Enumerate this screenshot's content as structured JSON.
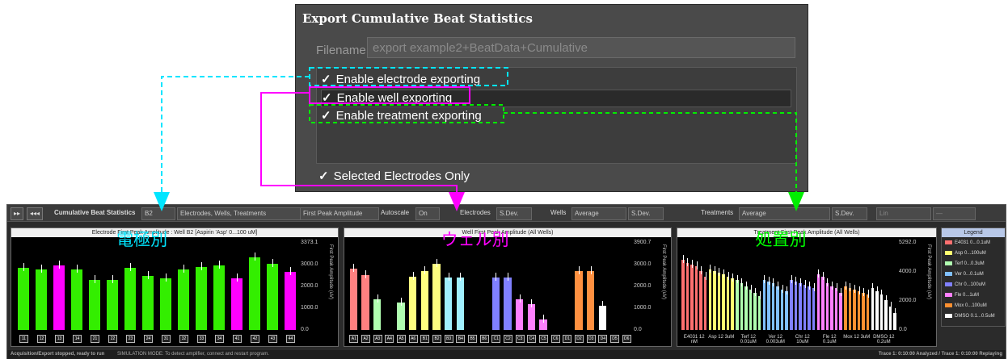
{
  "dialog": {
    "title": "Export Cumulative Beat Statistics",
    "filename_label": "Filename",
    "filename_value": "export example2+BeatData+Cumulative",
    "options": [
      {
        "label": "Enable electrode exporting",
        "checked": true
      },
      {
        "label": "Enable well exporting",
        "checked": true
      },
      {
        "label": "Enable treatment exporting",
        "checked": true
      }
    ],
    "selected_only": {
      "label": "Selected Electrodes Only",
      "checked": true
    },
    "check_glyph": "✓"
  },
  "toolbar": {
    "btn1": "▸▸",
    "btn2": "◂◂◂",
    "title": "Cumulative Beat Statistics",
    "well": "B2",
    "view": "Electrodes, Wells, Treatments",
    "metric": "First Peak Amplitude",
    "autoscale_label": "Autoscale",
    "autoscale_value": "On",
    "electrodes_label": "Electrodes",
    "electrodes_value": "S.Dev.",
    "wells_label": "Wells",
    "wells_value": "Average",
    "wells_err": "S.Dev.",
    "treatments_label": "Treatments",
    "treatments_value": "Average",
    "treatments_err": "S.Dev.",
    "scale": "Lin",
    "extra": "—"
  },
  "panels": {
    "electrode": {
      "title": "Electrode First Peak Amplitude : Well B2 [Aspirin 'Asp' 0...100 uM]",
      "label": "電極別",
      "label_color": "#00e5ff",
      "y_axis_label": "First Peak Amplitude (uV)",
      "y_ticks": [
        "3373.1",
        "3000.0",
        "2000.0",
        "1000.0",
        "0.0"
      ]
    },
    "well": {
      "title": "Well First Peak Amplitude (All Wells)",
      "label": "ウェル別",
      "label_color": "#ff00ff",
      "y_axis_label": "First Peak Amplitude (uV)",
      "y_ticks": [
        "3900.7",
        "3000.0",
        "2000.0",
        "1000.0",
        "0.0"
      ]
    },
    "treatment": {
      "title": "Treatment First Peak Amplitude (All Wells)",
      "label": "処置別",
      "label_color": "#00ff00",
      "y_axis_label": "First Peak Amplitude (uV)",
      "y_ticks": [
        "5292.0",
        "4000.0",
        "2000.0",
        "0.0"
      ]
    }
  },
  "legend": {
    "title": "Legend",
    "items": [
      {
        "label": "E4031 0...0.1uM",
        "color": "#ff7070"
      },
      {
        "label": "Asp 0...100uM",
        "color": "#ffff70"
      },
      {
        "label": "Terf 0...0.3uM",
        "color": "#b0ffb0"
      },
      {
        "label": "Ver 0...0.1uM",
        "color": "#80c0ff"
      },
      {
        "label": "Chr 0...100uM",
        "color": "#8080ff"
      },
      {
        "label": "Fle 0...1uM",
        "color": "#ff80ff"
      },
      {
        "label": "Mox 0...100uM",
        "color": "#ff9030"
      },
      {
        "label": "DMSO 0.1...0.5uM",
        "color": "#ffffff"
      }
    ]
  },
  "status": {
    "left": "Acquisition/Export stopped, ready to run",
    "mode": "SIMULATION MODE: To detect amplifier, connect and restart program.",
    "right": "Trace 1: 0:10:00 Analyzed / Trace 1: 0:10:00 Replaying"
  },
  "electrode_xlabels": [
    "11",
    "12",
    "13",
    "14",
    "21",
    "22",
    "23",
    "24",
    "31",
    "32",
    "33",
    "34",
    "41",
    "42",
    "43",
    "44"
  ],
  "well_xlabels": [
    "A1",
    "A2",
    "A3",
    "A4",
    "A5",
    "A6",
    "B1",
    "B2",
    "B3",
    "B4",
    "B5",
    "B6",
    "C1",
    "C2",
    "C3",
    "C4",
    "C5",
    "C6",
    "D1",
    "D2",
    "D3",
    "D4",
    "D5",
    "D6"
  ],
  "treatment_xlabels": [
    "E4031 12 nM",
    "Asp 12 3uM",
    "Terf 12 0.01uM",
    "Ver 12 0.003uM",
    "Chr 12 10uM",
    "Fle 12 0.1uM",
    "Mox 12 3uM",
    "DMSO 12 0.2uM"
  ],
  "chart_data": [
    {
      "type": "bar",
      "title": "Electrode First Peak Amplitude : Well B2 [Aspirin 'Asp' 0...100 uM]",
      "ylabel": "First Peak Amplitude (uV)",
      "ylim": [
        0,
        3373.1
      ],
      "categories": [
        "11",
        "12",
        "13",
        "14",
        "21",
        "22",
        "23",
        "24",
        "31",
        "32",
        "33",
        "34",
        "41",
        "42",
        "43",
        "44"
      ],
      "values": [
        2350,
        2300,
        2450,
        2300,
        1900,
        1900,
        2350,
        2050,
        1950,
        2300,
        2400,
        2450,
        1950,
        2750,
        2500,
        2200
      ],
      "colors": [
        "#33ee00",
        "#33ee00",
        "#ff00ff",
        "#33ee00",
        "#33ee00",
        "#33ee00",
        "#33ee00",
        "#33ee00",
        "#33ee00",
        "#33ee00",
        "#33ee00",
        "#33ee00",
        "#ff00ff",
        "#33ee00",
        "#33ee00",
        "#ff00ff"
      ]
    },
    {
      "type": "bar",
      "title": "Well First Peak Amplitude (All Wells)",
      "ylabel": "First Peak Amplitude (uV)",
      "ylim": [
        0,
        3900.7
      ],
      "categories": [
        "A1",
        "A2",
        "A3",
        "A4",
        "A5",
        "A6",
        "B1",
        "B2",
        "B3",
        "B4",
        "B5",
        "B6",
        "C1",
        "C2",
        "C3",
        "C4",
        "C5",
        "C6",
        "D1",
        "D2",
        "D3",
        "D4",
        "D5",
        "D6"
      ],
      "values": [
        2700,
        2400,
        1350,
        0,
        1200,
        2350,
        2600,
        2900,
        2300,
        2300,
        0,
        0,
        2300,
        2300,
        1350,
        1150,
        450,
        0,
        0,
        2600,
        2600,
        1050,
        0,
        0
      ],
      "colors": [
        "#ff8080",
        "#ff8080",
        "#b0ffb0",
        "#b0ffb0",
        "#b0ffb0",
        "#ffff80",
        "#ffff80",
        "#ffff80",
        "#a0f0ff",
        "#a0f0ff",
        "#a0f0ff",
        "#a0f0ff",
        "#8080ff",
        "#8080ff",
        "#ff80ff",
        "#ff80ff",
        "#ff80ff",
        "#ff80ff",
        "#ff9040",
        "#ff9040",
        "#ff9040",
        "#ffffff",
        "#ffffff",
        "#ffffff"
      ]
    },
    {
      "type": "bar",
      "title": "Treatment First Peak Amplitude (All Wells)",
      "ylabel": "First Peak Amplitude (uV)",
      "ylim": [
        0,
        5292.0
      ],
      "categories": [
        "E4031",
        "Asp",
        "Terf",
        "Ver",
        "Chr",
        "Fle",
        "Mox",
        "DMSO"
      ],
      "series": [
        {
          "name": "E4031 0...0.1uM",
          "values": [
            4200,
            4000,
            3900,
            3800,
            3500,
            3200
          ]
        },
        {
          "name": "Asp 0...100uM",
          "values": [
            3600,
            3500,
            3400,
            3300,
            3200,
            3100
          ]
        },
        {
          "name": "Terf 0...0.3uM",
          "values": [
            3000,
            2800,
            2600,
            2400,
            2200,
            2000
          ]
        },
        {
          "name": "Ver 0...0.1uM",
          "values": [
            3000,
            2900,
            2800,
            2600,
            2400,
            2300
          ]
        },
        {
          "name": "Chr 0...100uM",
          "values": [
            3000,
            2900,
            2800,
            2700,
            2600,
            2500
          ]
        },
        {
          "name": "Fle 0...1uM",
          "values": [
            3300,
            3200,
            2800,
            2600,
            2500,
            2200
          ]
        },
        {
          "name": "Mox 0...100uM",
          "values": [
            2600,
            2500,
            2400,
            2300,
            2200,
            2100
          ]
        },
        {
          "name": "DMSO 0.1...0.5uM",
          "values": [
            2500,
            2300,
            2100,
            1800,
            1400,
            1000
          ]
        }
      ]
    }
  ]
}
